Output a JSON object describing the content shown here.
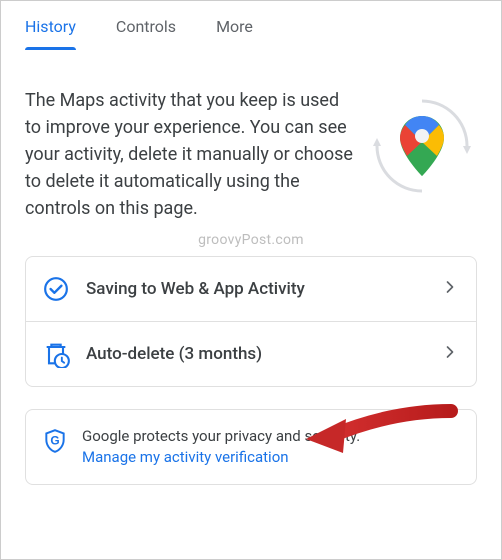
{
  "tabs": {
    "history": "History",
    "controls": "Controls",
    "more": "More"
  },
  "description": "The Maps activity that you keep is used to improve your experience. You can see your activity, delete it manually or choose to delete it automatically using the controls on this page.",
  "watermark": "groovyPost.com",
  "rows": {
    "saving": {
      "label": "Saving to Web & App Activity"
    },
    "autodelete": {
      "label": "Auto-delete (3 months)"
    }
  },
  "info": {
    "text": "Google protects your privacy and security.",
    "link": "Manage my activity verification"
  },
  "colors": {
    "accent": "#1a73e8"
  }
}
